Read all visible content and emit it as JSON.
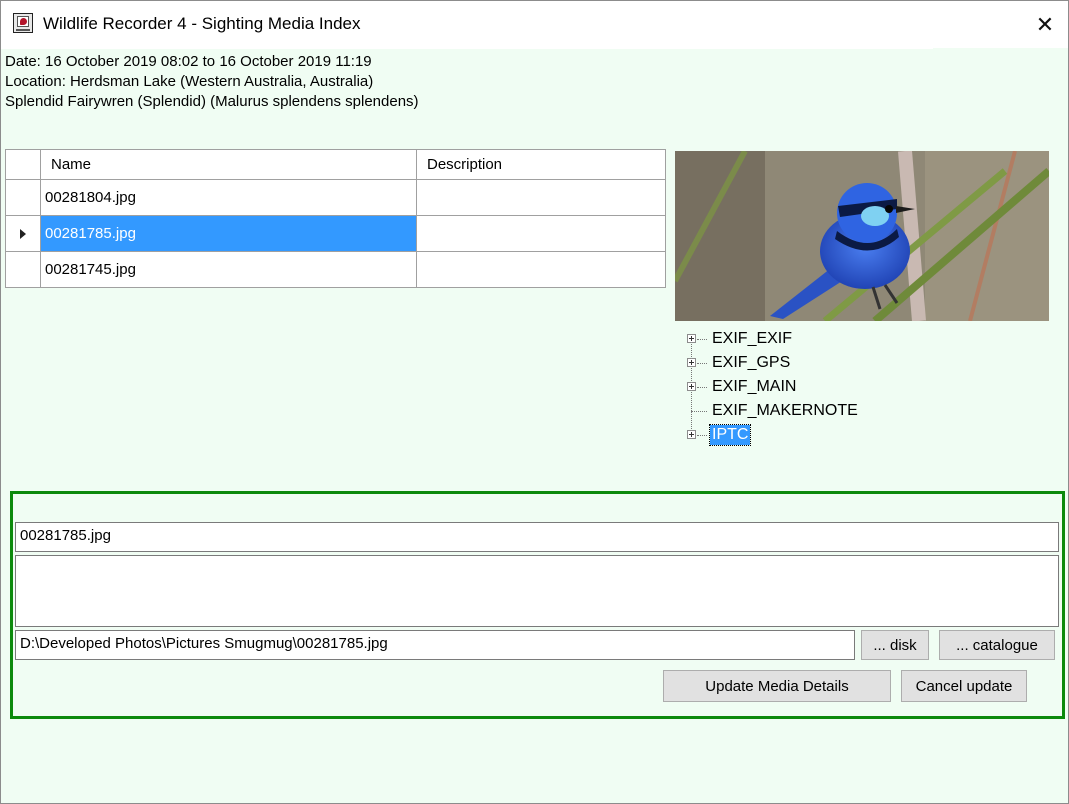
{
  "window": {
    "title": "Wildlife Recorder 4 - Sighting Media Index",
    "close_glyph": "✕"
  },
  "info": {
    "date": "Date: 16 October 2019 08:02 to 16 October 2019 11:19",
    "location": "Location: Herdsman Lake (Western Australia, Australia)",
    "species": "Splendid Fairywren (Splendid) (Malurus splendens splendens)"
  },
  "grid": {
    "columns": [
      "Name",
      "Description"
    ],
    "rows": [
      {
        "name": "00281804.jpg",
        "description": ""
      },
      {
        "name": "00281785.jpg",
        "description": ""
      },
      {
        "name": "00281745.jpg",
        "description": ""
      }
    ],
    "selected_row": 1
  },
  "tree": {
    "items": [
      "EXIF_EXIF",
      "EXIF_GPS",
      "EXIF_MAIN",
      "EXIF_MAKERNOTE",
      "IPTC"
    ]
  },
  "edit": {
    "name_value": "00281785.jpg",
    "description_value": "",
    "path_value": "D:\\Developed Photos\\Pictures Smugmug\\00281785.jpg",
    "disk_label": "... disk",
    "catalogue_label": "... catalogue",
    "update_label": "Update Media Details",
    "cancel_label": "Cancel update"
  },
  "colors": {
    "background": "#f0fdf3",
    "selection": "#3399ff",
    "group_border": "#0c8a0c"
  },
  "icons": {
    "app": "wildlife-recorder-app-icon",
    "close": "close-icon",
    "row_pointer": "row-pointer-icon",
    "expand": "plus-expander-icon"
  }
}
